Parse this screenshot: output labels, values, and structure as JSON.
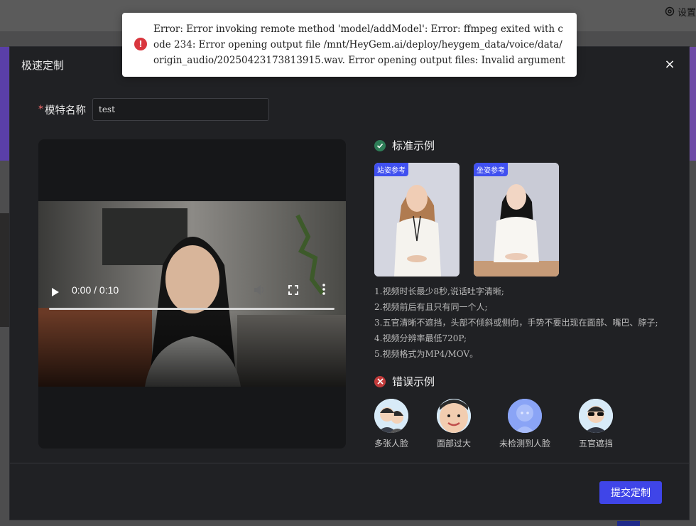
{
  "app": {
    "settings_label": "设置"
  },
  "modal": {
    "title": "极速定制",
    "close_label": "×",
    "name_label": "模特名称",
    "name_value": "test",
    "video": {
      "time": "0:00 / 0:10",
      "progress": 0
    },
    "good_examples": {
      "title": "标准示例",
      "cards": [
        {
          "tag": "站姿参考"
        },
        {
          "tag": "坐姿参考"
        }
      ],
      "rules": [
        "1.视频时长最少8秒,说话吐字清晰;",
        "2.视频前后有且只有同一个人;",
        "3.五官清晰不遮挡，头部不倾斜或侧向，手势不要出现在面部、嘴巴、脖子;",
        "4.视频分辨率最低720P;",
        "5.视频格式为MP4/MOV。"
      ]
    },
    "bad_examples": {
      "title": "错误示例",
      "items": [
        {
          "label": "多张人脸"
        },
        {
          "label": "面部过大"
        },
        {
          "label": "未检测到人脸"
        },
        {
          "label": "五官遮挡"
        }
      ]
    },
    "submit_label": "提交定制"
  },
  "toast": {
    "message": "Error: Error invoking remote method 'model/addModel': Error: ffmpeg exited with code 234: Error opening output file /mnt/HeyGem.ai/deploy/heygem_data/voice/data/origin_audio/20250423173813915.wav. Error opening output files: Invalid argument",
    "icon": "!"
  },
  "colors": {
    "accent": "#3f45e8",
    "error": "#d9363e",
    "success": "#2e7d57"
  }
}
